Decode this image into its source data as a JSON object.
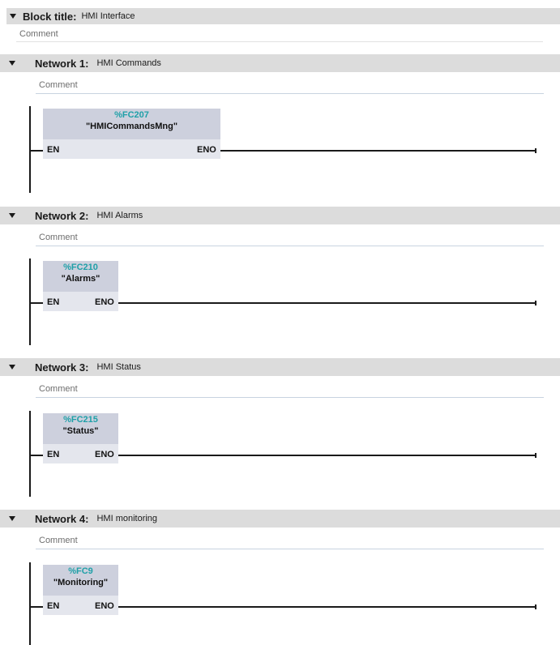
{
  "block": {
    "title_label": "Block title:",
    "title_value": "HMI Interface",
    "comment": "Comment"
  },
  "networks": [
    {
      "label": "Network 1:",
      "title": "HMI Commands",
      "comment": "Comment",
      "fc_address": "%FC207",
      "fc_name": "\"HMICommandsMng\"",
      "en": "EN",
      "eno": "ENO"
    },
    {
      "label": "Network 2:",
      "title": "HMI Alarms",
      "comment": "Comment",
      "fc_address": "%FC210",
      "fc_name": "\"Alarms\"",
      "en": "EN",
      "eno": "ENO"
    },
    {
      "label": "Network 3:",
      "title": "HMI Status",
      "comment": "Comment",
      "fc_address": "%FC215",
      "fc_name": "\"Status\"",
      "en": "EN",
      "eno": "ENO"
    },
    {
      "label": "Network 4:",
      "title": "HMI monitoring",
      "comment": "Comment",
      "fc_address": "%FC9",
      "fc_name": "\"Monitoring\"",
      "en": "EN",
      "eno": "ENO"
    }
  ],
  "colors": {
    "header_bg": "#dcdcdc",
    "fc_address": "#1fa0a8",
    "box_head": "#cdd0dd",
    "box_body": "#e4e6ed"
  }
}
